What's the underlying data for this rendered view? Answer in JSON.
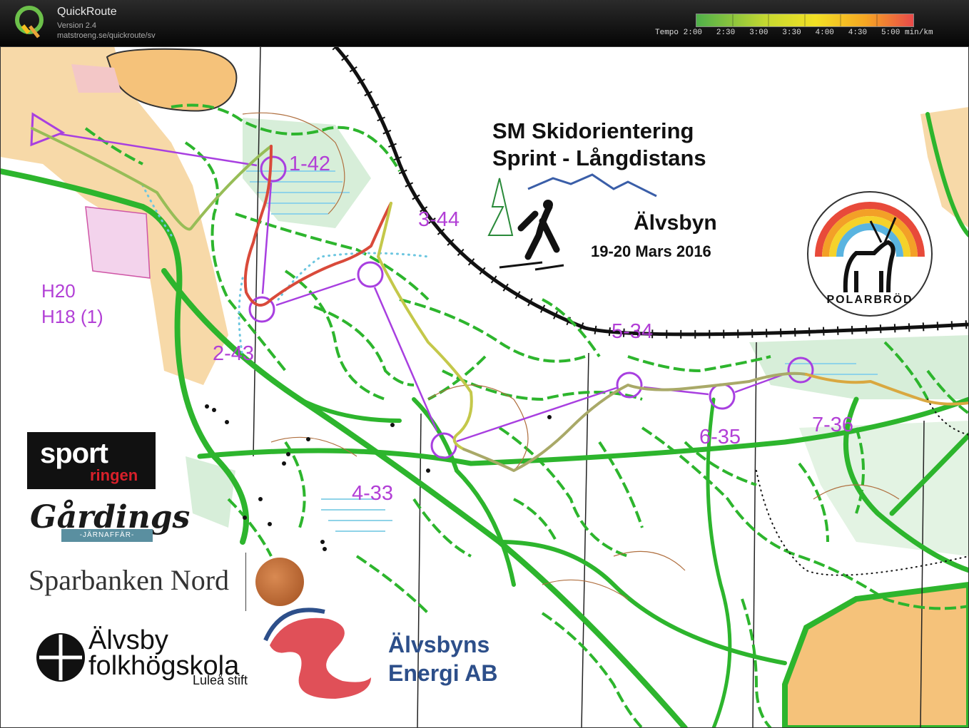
{
  "app": {
    "name": "QuickRoute",
    "version": "Version 2.4",
    "url": "matstroeng.se/quickroute/sv"
  },
  "pace_scale": {
    "label": "Tempo",
    "ticks": [
      "2:00",
      "2:30",
      "3:00",
      "3:30",
      "4:00",
      "4:30",
      "5:00"
    ],
    "unit": "min/km",
    "colors": [
      "#4fb04a",
      "#8cc63f",
      "#c8d930",
      "#f2e024",
      "#f5a623",
      "#ef6d3b",
      "#e94a4a"
    ]
  },
  "event": {
    "title_line1": "SM Skidorientering",
    "title_line2": "Sprint - Långdistans",
    "place": "Älvsbyn",
    "date": "19-20 Mars 2016"
  },
  "classes": [
    "H20",
    "H18 (1)"
  ],
  "controls": [
    {
      "id": "1-42"
    },
    {
      "id": "2-43"
    },
    {
      "id": "3-44"
    },
    {
      "id": "4-33"
    },
    {
      "id": "5-34"
    },
    {
      "id": "6-35"
    },
    {
      "id": "7-36"
    }
  ],
  "sponsors": {
    "polarbrod": "POLARBRÖD",
    "sportringen_1": "sport",
    "sportringen_2": "ringen",
    "gardings": "Gårdings",
    "gardings_sub": "-JÄRNAFFÄR-",
    "sparbanken": "Sparbanken Nord",
    "folkhogskola_1": "Älvsby",
    "folkhogskola_2": "folkhögskola",
    "folkhogskola_3": "Luleå stift",
    "energi_1": "Älvsbyns",
    "energi_2": "Energi AB"
  },
  "colors": {
    "course": "#b23fd6",
    "track": "#2db52d",
    "open_land": "#f6c98a",
    "marsh": "#8fd3e8"
  }
}
